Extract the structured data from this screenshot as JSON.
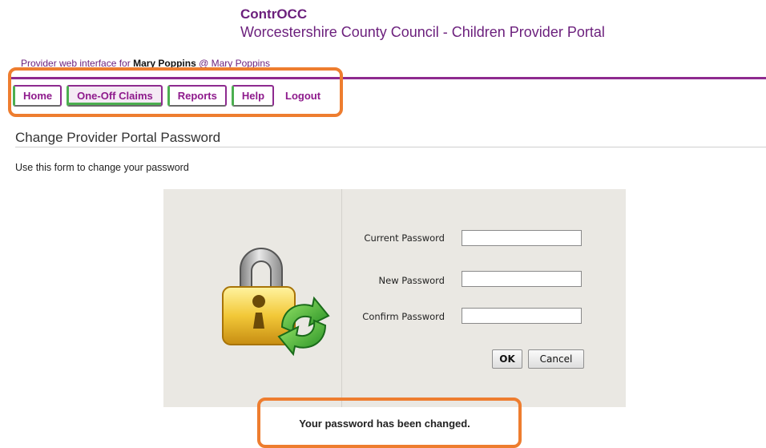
{
  "header": {
    "brand": "ContrOCC",
    "subtitle": "Worcestershire County Council - Children Provider Portal"
  },
  "provider_line": {
    "prefix": "Provider web interface for",
    "name": "Mary Poppins",
    "suffix": "@ Mary Poppins"
  },
  "nav": {
    "items": [
      {
        "label": "Home"
      },
      {
        "label": "One-Off Claims"
      },
      {
        "label": "Reports"
      },
      {
        "label": "Help"
      },
      {
        "label": "Logout"
      }
    ]
  },
  "page": {
    "title": "Change Provider Portal Password",
    "intro": "Use this form to change your password"
  },
  "form": {
    "current_label": "Current Password",
    "current_value": "",
    "new_label": "New Password",
    "new_value": "",
    "confirm_label": "Confirm Password",
    "confirm_value": "",
    "ok_label": "OK",
    "cancel_label": "Cancel"
  },
  "message": "Your password has been changed.",
  "colors": {
    "brand": "#6b1f7c",
    "nav_border": "#8e2a8f",
    "nav_accent": "#4caf50",
    "highlight": "#ee7d2f",
    "panel_bg": "#eae8e3"
  }
}
